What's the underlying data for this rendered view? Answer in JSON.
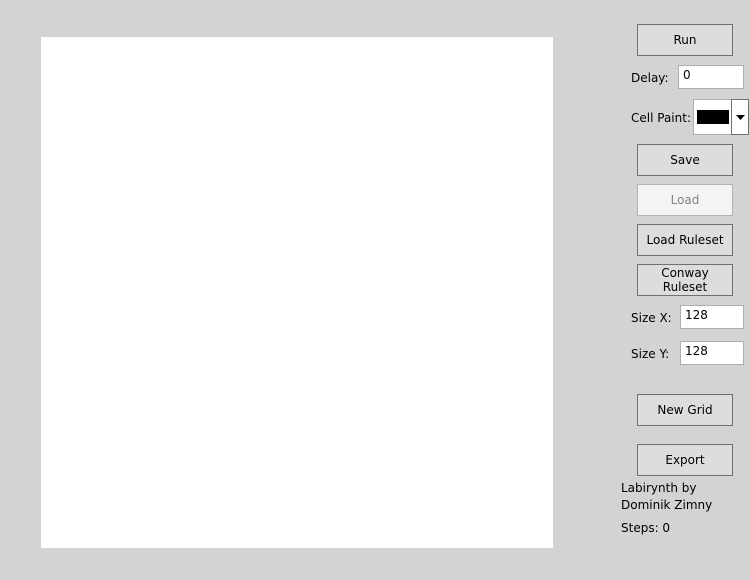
{
  "toolbar": {
    "run_label": "Run",
    "save_label": "Save",
    "load_label": "Load",
    "load_ruleset_label": "Load Ruleset",
    "conway_ruleset_label": "Conway Ruleset",
    "new_grid_label": "New Grid",
    "export_label": "Export"
  },
  "delay": {
    "label": "Delay:",
    "value": "0"
  },
  "cell_paint": {
    "label": "Cell Paint:",
    "selected_color": "#000000"
  },
  "size_x": {
    "label": "Size X:",
    "value": "128"
  },
  "size_y": {
    "label": "Size Y:",
    "value": "128"
  },
  "credit_text": "Labirynth by Dominik Zimny",
  "steps_text": "Steps: 0",
  "colors": {
    "background": "#d3d3d3",
    "grid_canvas": "#ffffff",
    "button_face": "#dddddd",
    "button_border": "#707070",
    "disabled_text": "#838383"
  },
  "icons": {
    "combo_dropdown": "chevron-down-icon"
  }
}
